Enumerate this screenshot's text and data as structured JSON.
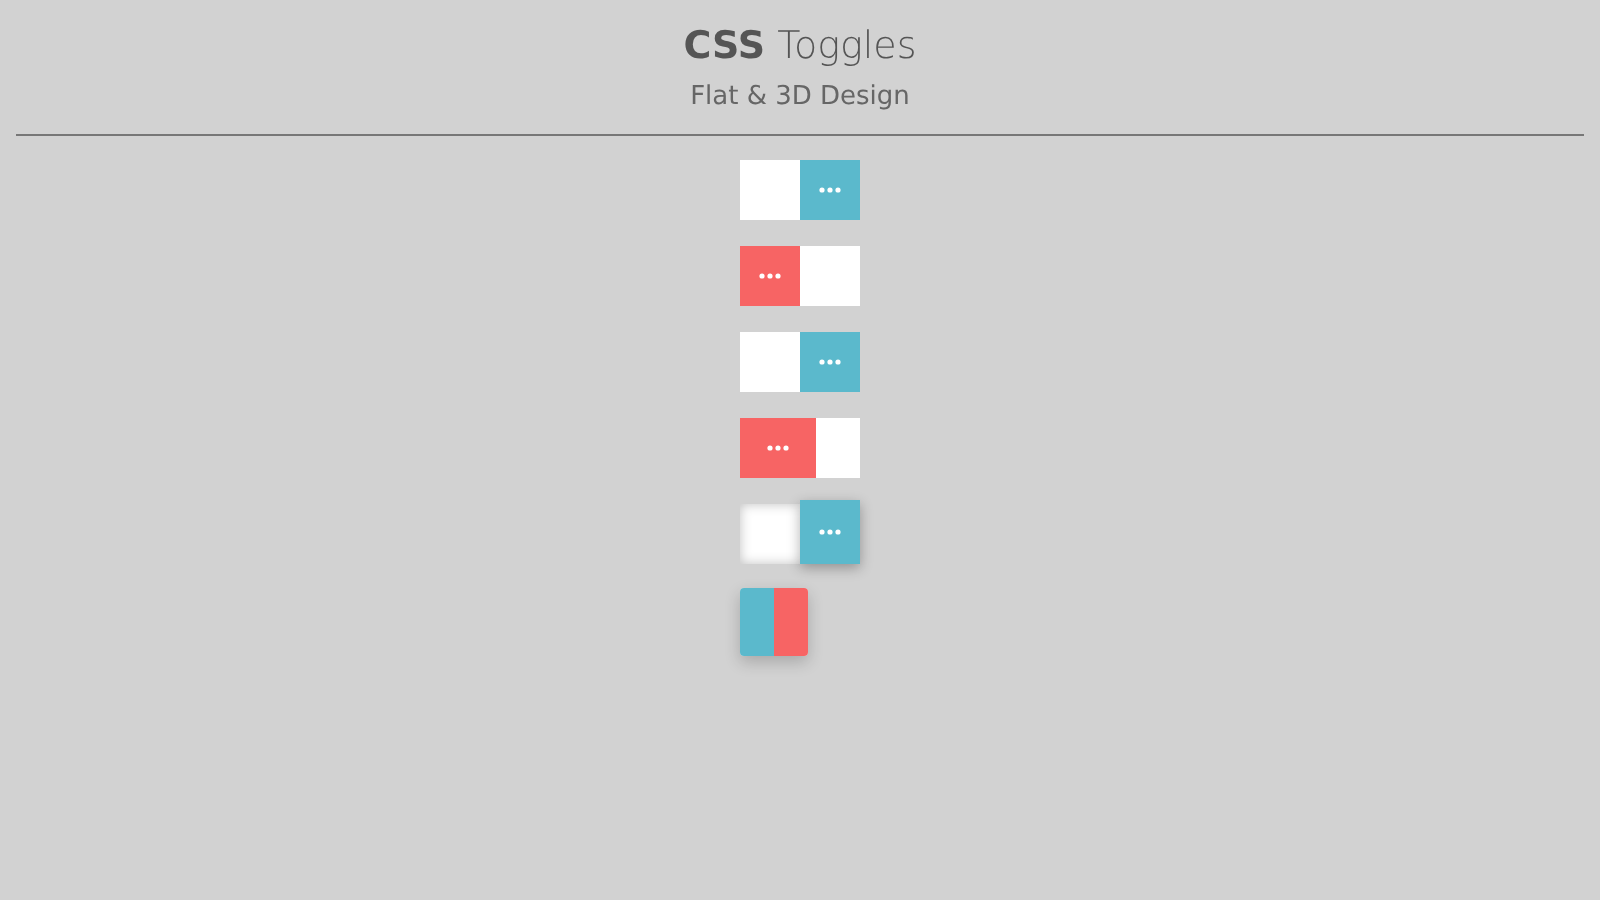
{
  "header": {
    "title": "**CSS** Toggles",
    "subtitle": "Flat & 3D Design"
  },
  "toggles": [
    {
      "kind": "flat",
      "checked": true
    },
    {
      "kind": "flat",
      "checked": false
    },
    {
      "kind": "flat",
      "checked": true
    },
    {
      "kind": "wide",
      "checked": false
    },
    {
      "kind": "raised",
      "checked": true
    },
    {
      "kind": "flip",
      "checked": true
    }
  ]
}
